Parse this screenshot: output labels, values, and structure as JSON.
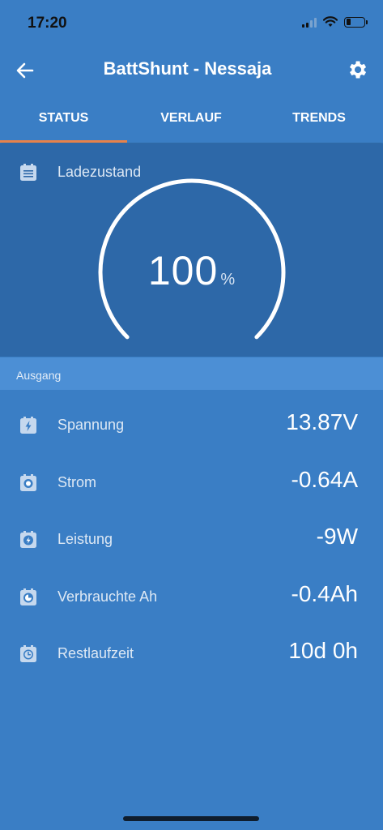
{
  "status_bar": {
    "time": "17:20"
  },
  "app_bar": {
    "title": "BattShunt - Nessaja"
  },
  "tabs": [
    {
      "label": "STATUS",
      "active": true
    },
    {
      "label": "VERLAUF",
      "active": false
    },
    {
      "label": "TRENDS",
      "active": false
    }
  ],
  "state_of_charge": {
    "label": "Ladezustand",
    "value": "100",
    "unit": "%",
    "level": 1.0
  },
  "section": {
    "label": "Ausgang"
  },
  "readings": [
    {
      "name": "Spannung",
      "value": "13.87V",
      "icon": "lightning-bolt-icon"
    },
    {
      "name": "Strom",
      "value": "-0.64A",
      "icon": "current-dot-icon"
    },
    {
      "name": "Leistung",
      "value": "-9W",
      "icon": "power-bolt-icon"
    },
    {
      "name": "Verbrauchte Ah",
      "value": "-0.4Ah",
      "icon": "consumed-gauge-icon"
    },
    {
      "name": "Restlaufzeit",
      "value": "10d 0h",
      "icon": "clock-icon"
    }
  ],
  "colors": {
    "background": "#3a7ec5",
    "gauge_panel": "#2d68a8",
    "section_header": "#4c8fd5",
    "tab_indicator": "#e8824a"
  }
}
